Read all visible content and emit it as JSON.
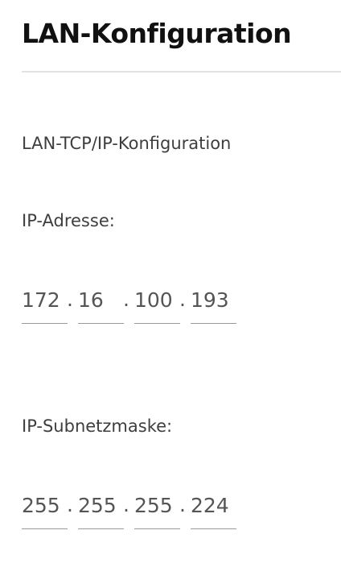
{
  "page": {
    "title": "LAN-Konfiguration",
    "section_label": "LAN-TCP/IP-Konfiguration"
  },
  "ip_address": {
    "label": "IP-Adresse:",
    "octets": [
      "172",
      "16",
      "100",
      "193"
    ],
    "separator": "."
  },
  "subnet_mask": {
    "label": "IP-Subnetzmaske:",
    "octets": [
      "255",
      "255",
      "255",
      "224"
    ],
    "separator": "."
  }
}
